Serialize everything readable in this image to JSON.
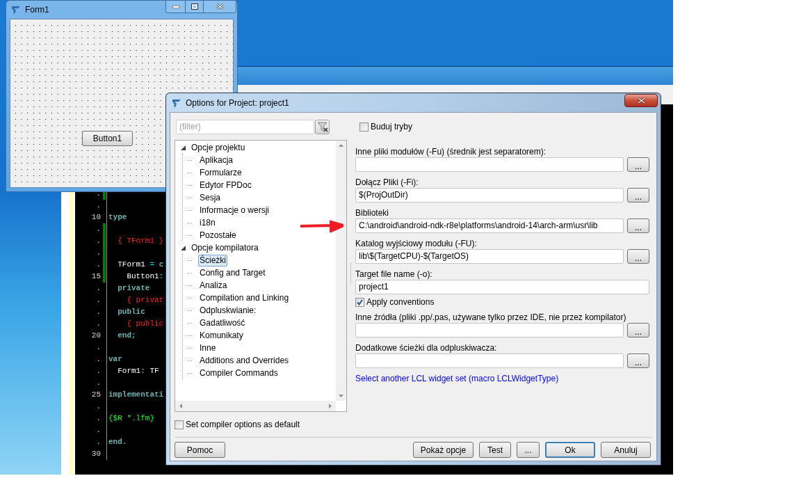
{
  "form_window": {
    "title": "Form1",
    "button": "Button1"
  },
  "editor": {
    "lines": [
      {
        "gutter": ".",
        "modified": true
      },
      {
        "gutter": ".",
        "modified": false
      },
      {
        "gutter": "10",
        "modified": false,
        "tokens": [
          {
            "text": "type",
            "kind": "keyword"
          }
        ]
      },
      {
        "gutter": ".",
        "modified": true
      },
      {
        "gutter": ".",
        "modified": true,
        "tokens": [
          {
            "text": "  { TForm1 }",
            "kind": "comment"
          }
        ]
      },
      {
        "gutter": ".",
        "modified": true
      },
      {
        "gutter": ".",
        "modified": true,
        "tokens": [
          {
            "text": "  TForm1 ",
            "kind": "plain"
          },
          {
            "text": "=",
            "kind": "symbol"
          },
          {
            "text": " c",
            "kind": "keyword"
          }
        ]
      },
      {
        "gutter": "15",
        "modified": true,
        "tokens": [
          {
            "text": "    Button1",
            "kind": "plain"
          },
          {
            "text": ":",
            "kind": "symbol"
          }
        ]
      },
      {
        "gutter": ".",
        "modified": false,
        "tokens": [
          {
            "text": "  private",
            "kind": "keyword"
          }
        ]
      },
      {
        "gutter": ".",
        "modified": false,
        "tokens": [
          {
            "text": "    { privat",
            "kind": "comment"
          }
        ]
      },
      {
        "gutter": ".",
        "modified": false,
        "tokens": [
          {
            "text": "  public",
            "kind": "keyword"
          }
        ]
      },
      {
        "gutter": ".",
        "modified": false,
        "tokens": [
          {
            "text": "    { public",
            "kind": "comment"
          }
        ]
      },
      {
        "gutter": "20",
        "modified": false,
        "tokens": [
          {
            "text": "  end",
            "kind": "keyword"
          },
          {
            "text": ";",
            "kind": "symbol"
          }
        ]
      },
      {
        "gutter": ".",
        "modified": false
      },
      {
        "gutter": ".",
        "modified": false,
        "tokens": [
          {
            "text": "var",
            "kind": "keyword"
          }
        ]
      },
      {
        "gutter": ".",
        "modified": false,
        "tokens": [
          {
            "text": "  Form1",
            "kind": "plain"
          },
          {
            "text": ":",
            "kind": "symbol"
          },
          {
            "text": " TF",
            "kind": "plain"
          }
        ]
      },
      {
        "gutter": ".",
        "modified": false
      },
      {
        "gutter": "25",
        "modified": false,
        "tokens": [
          {
            "text": "implementati",
            "kind": "keyword"
          }
        ]
      },
      {
        "gutter": ".",
        "modified": false
      },
      {
        "gutter": ".",
        "modified": false,
        "tokens": [
          {
            "text": "{$R *.lfm}",
            "kind": "directive"
          }
        ]
      },
      {
        "gutter": ".",
        "modified": false
      },
      {
        "gutter": ".",
        "modified": false,
        "tokens": [
          {
            "text": "end.",
            "kind": "keyword"
          }
        ]
      },
      {
        "gutter": "30",
        "modified": false
      }
    ]
  },
  "dialog": {
    "title": "Options for Project: project1",
    "filter": {
      "placeholder": "(filter)"
    },
    "tree": [
      {
        "label": "Opcje projektu",
        "expanded": true,
        "selected": false,
        "children": [
          {
            "label": "Aplikacja",
            "selected": false
          },
          {
            "label": "Formularze",
            "selected": false
          },
          {
            "label": "Edytor FPDoc",
            "selected": false
          },
          {
            "label": "Sesja",
            "selected": false
          },
          {
            "label": "Informacje o wersji",
            "selected": false
          },
          {
            "label": "i18n",
            "selected": false
          },
          {
            "label": "Pozostałe",
            "selected": false
          }
        ]
      },
      {
        "label": "Opcje kompilatora",
        "expanded": true,
        "selected": false,
        "children": [
          {
            "label": "Ścieżki",
            "selected": true
          },
          {
            "label": "Config and Target",
            "selected": false
          },
          {
            "label": "Analiza",
            "selected": false
          },
          {
            "label": "Compilation and Linking",
            "selected": false
          },
          {
            "label": "Odpluskwianie:",
            "selected": false
          },
          {
            "label": "Gadatliwość",
            "selected": false
          },
          {
            "label": "Komunikaty",
            "selected": false
          },
          {
            "label": "Inne",
            "selected": false
          },
          {
            "label": "Additions and Overrides",
            "selected": false
          },
          {
            "label": "Compiler Commands",
            "selected": false
          }
        ]
      }
    ],
    "set_default": {
      "label": "Set compiler options as default",
      "checked": false
    },
    "build_modes": {
      "label": "Buduj tryby",
      "checked": false
    },
    "options": [
      {
        "kind": "path",
        "label": "Inne pliki modułów (-Fu) (średnik jest separatorem):",
        "button": "..."
      },
      {
        "kind": "path",
        "label": "Dołącz Pliki (-Fi):",
        "value": "$(ProjOutDir)",
        "button": "..."
      },
      {
        "kind": "path",
        "label": "Biblioteki",
        "value": "C:\\android\\android-ndk-r8e\\platforms\\android-14\\arch-arm\\usr\\lib",
        "button": "..."
      },
      {
        "kind": "path",
        "label": "Katalog wyjściowy modułu (-FU):",
        "value": "lib\\$(TargetCPU)-$(TargetOS)",
        "button": "..."
      },
      {
        "kind": "text",
        "label": "Target file name (-o):",
        "value": "project1"
      },
      {
        "kind": "checkbox",
        "label": "Apply conventions",
        "checked": true
      },
      {
        "kind": "path",
        "label": "Inne źródła (pliki .pp/.pas, używane tylko przez IDE, nie przez kompilator)",
        "button": "..."
      },
      {
        "kind": "path",
        "label": "Dodatkowe ścieżki dla odpluskiwacza:",
        "button": "..."
      },
      {
        "kind": "link",
        "label": "Select another LCL widget set (macro LCLWidgetType)"
      }
    ],
    "help_button": "Pomoc",
    "buttons": [
      {
        "label": "Pokaż opcje",
        "focused": false
      },
      {
        "label": "Test",
        "focused": false
      },
      {
        "label": "...",
        "focused": false
      },
      {
        "label": "Ok",
        "focused": true
      },
      {
        "label": "Anuluj",
        "focused": false
      }
    ]
  }
}
